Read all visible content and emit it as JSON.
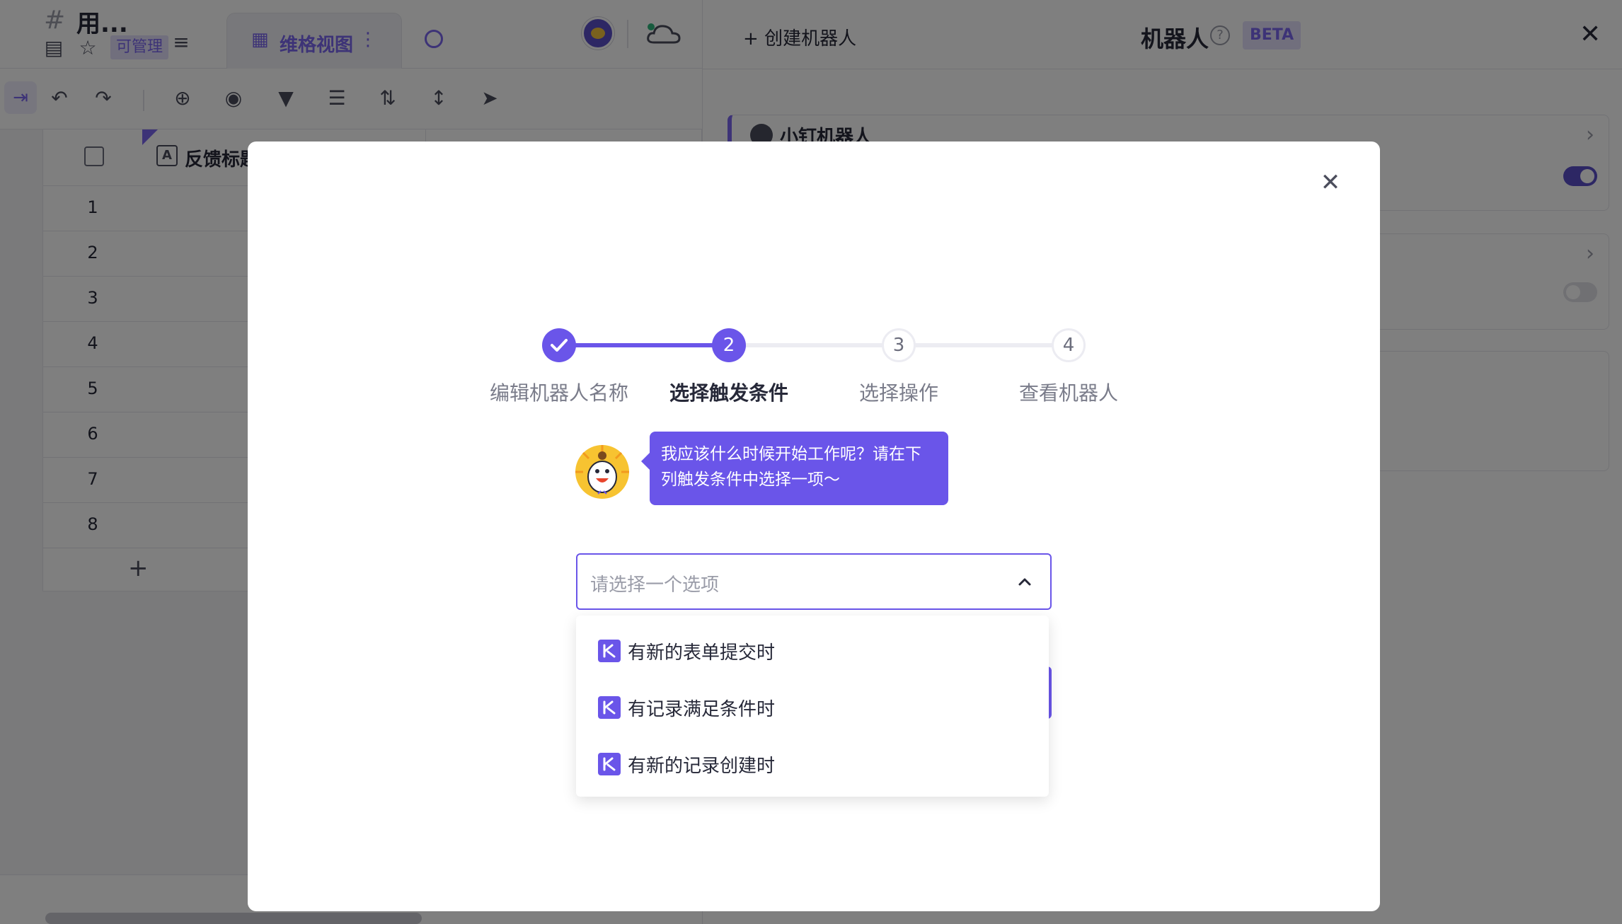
{
  "header": {
    "sheet_name": "用...",
    "permission_badge": "可管理",
    "view_tab_label": "维格视图"
  },
  "grid": {
    "column_header": "反馈标题",
    "rows": [
      "1",
      "2",
      "3",
      "4",
      "5",
      "6",
      "7",
      "8"
    ],
    "add_row": "+"
  },
  "robot_panel": {
    "create_label": "创建机器人",
    "title": "机器人",
    "beta_badge": "BETA",
    "robots": [
      {
        "name": "小钉机器人",
        "enabled": true
      },
      {
        "name": "",
        "enabled": false
      }
    ]
  },
  "modal": {
    "steps": [
      {
        "number": "1",
        "label": "编辑机器人名称",
        "state": "done"
      },
      {
        "number": "2",
        "label": "选择触发条件",
        "state": "current"
      },
      {
        "number": "3",
        "label": "选择操作",
        "state": "todo"
      },
      {
        "number": "4",
        "label": "查看机器人",
        "state": "todo"
      }
    ],
    "bubble_text": "我应该什么时候开始工作呢？请在下列触发条件中选择一项～",
    "select_placeholder": "请选择一个选项",
    "options": [
      {
        "label": "有新的表单提交时",
        "icon": "vika-logo-icon"
      },
      {
        "label": "有记录满足条件时",
        "icon": "vika-logo-icon"
      },
      {
        "label": "有新的记录创建时",
        "icon": "vika-logo-icon"
      }
    ]
  },
  "colors": {
    "accent": "#6a55e9",
    "accent_light": "#e2defa",
    "overlay": "rgba(0,0,0,0.5)"
  }
}
